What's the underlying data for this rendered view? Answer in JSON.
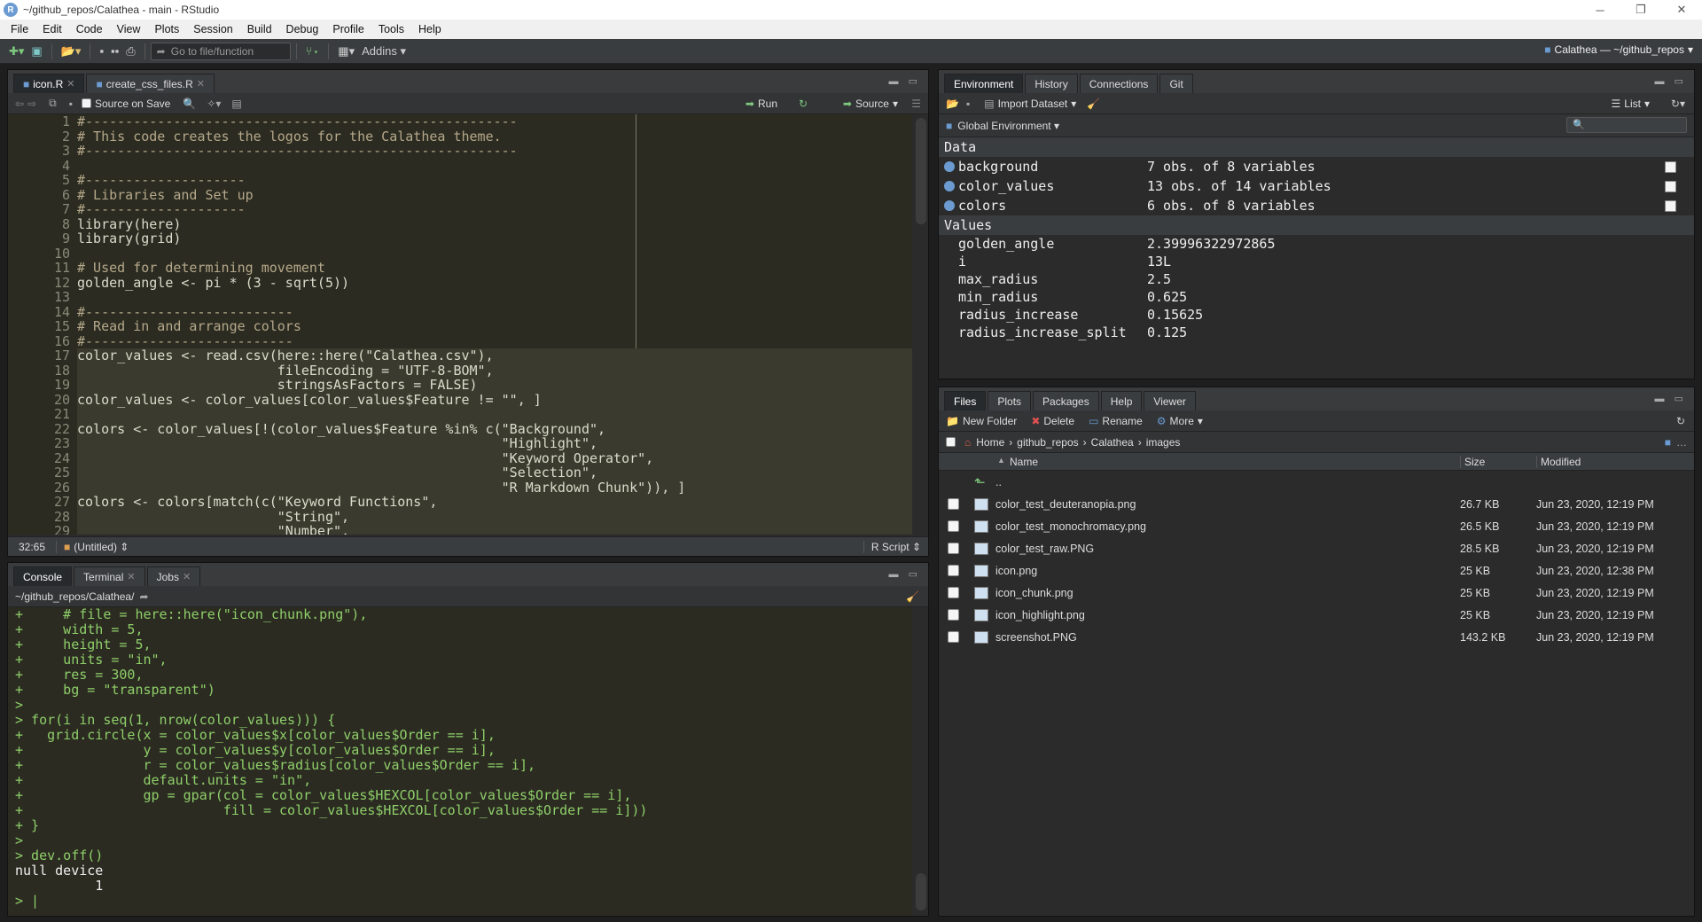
{
  "window": {
    "title": "~/github_repos/Calathea - main - RStudio",
    "app_icon": "R"
  },
  "menu": [
    "File",
    "Edit",
    "Code",
    "View",
    "Plots",
    "Session",
    "Build",
    "Debug",
    "Profile",
    "Tools",
    "Help"
  ],
  "toolbar": {
    "goto_placeholder": "Go to file/function",
    "addins": "Addins"
  },
  "project": "Calathea — ~/github_repos",
  "source": {
    "tabs": [
      {
        "label": "icon.R",
        "active": true
      },
      {
        "label": "create_css_files.R",
        "active": false
      }
    ],
    "source_on_save": "Source on Save",
    "run": "Run",
    "source": "Source",
    "line_numbers": [
      "1",
      "2",
      "3",
      "4",
      "5",
      "6",
      "7",
      "8",
      "9",
      "10",
      "11",
      "12",
      "13",
      "14",
      "15",
      "16",
      "17",
      "18",
      "19",
      "20",
      "21",
      "22",
      "23",
      "24",
      "25",
      "26",
      "27",
      "28",
      "29"
    ],
    "lines": [
      "#------------------------------------------------------",
      "# This code creates the logos for the Calathea theme.",
      "#------------------------------------------------------",
      "",
      "#--------------------",
      "# Libraries and Set up",
      "#--------------------",
      "library(here)",
      "library(grid)",
      "",
      "# Used for determining movement",
      "golden_angle <- pi * (3 - sqrt(5))",
      "",
      "#--------------------------",
      "# Read in and arrange colors",
      "#--------------------------",
      "color_values <- read.csv(here::here(\"Calathea.csv\"),",
      "                         fileEncoding = \"UTF-8-BOM\",",
      "                         stringsAsFactors = FALSE)",
      "color_values <- color_values[color_values$Feature != \"\", ]",
      "",
      "colors <- color_values[!(color_values$Feature %in% c(\"Background\",",
      "                                                     \"Highlight\",",
      "                                                     \"Keyword Operator\",",
      "                                                     \"Selection\",",
      "                                                     \"R Markdown Chunk\")), ]",
      "colors <- colors[match(c(\"Keyword Functions\",",
      "                         \"String\",",
      "                         \"Number\","
    ],
    "cursor": "32:65",
    "scope": "(Untitled)",
    "filetype": "R Script"
  },
  "console": {
    "tabs": [
      {
        "label": "Console",
        "active": true
      },
      {
        "label": "Terminal",
        "active": false
      },
      {
        "label": "Jobs",
        "active": false
      }
    ],
    "path": "~/github_repos/Calathea/",
    "lines": [
      {
        "t": "+     # file = here::here(\"icon_chunk.png\"),",
        "out": false
      },
      {
        "t": "+     width = 5,",
        "out": false
      },
      {
        "t": "+     height = 5,",
        "out": false
      },
      {
        "t": "+     units = \"in\",",
        "out": false
      },
      {
        "t": "+     res = 300,",
        "out": false
      },
      {
        "t": "+     bg = \"transparent\")",
        "out": false
      },
      {
        "t": ">",
        "out": false
      },
      {
        "t": "> for(i in seq(1, nrow(color_values))) {",
        "out": false
      },
      {
        "t": "+   grid.circle(x = color_values$x[color_values$Order == i],",
        "out": false
      },
      {
        "t": "+               y = color_values$y[color_values$Order == i],",
        "out": false
      },
      {
        "t": "+               r = color_values$radius[color_values$Order == i],",
        "out": false
      },
      {
        "t": "+               default.units = \"in\",",
        "out": false
      },
      {
        "t": "+               gp = gpar(col = color_values$HEXCOL[color_values$Order == i],",
        "out": false
      },
      {
        "t": "+                         fill = color_values$HEXCOL[color_values$Order == i]))",
        "out": false
      },
      {
        "t": "+ }",
        "out": false
      },
      {
        "t": ">",
        "out": false
      },
      {
        "t": "> dev.off()",
        "out": false
      },
      {
        "t": "null device",
        "out": true
      },
      {
        "t": "          1",
        "out": true
      },
      {
        "t": "> |",
        "out": false
      }
    ]
  },
  "environment": {
    "tabs": [
      {
        "label": "Environment",
        "active": true
      },
      {
        "label": "History",
        "active": false
      },
      {
        "label": "Connections",
        "active": false
      },
      {
        "label": "Git",
        "active": false
      }
    ],
    "import": "Import Dataset",
    "list": "List",
    "scope": "Global Environment",
    "data_header": "Data",
    "data": [
      {
        "name": "background",
        "value": "7 obs. of 8 variables"
      },
      {
        "name": "color_values",
        "value": "13 obs. of 14 variables"
      },
      {
        "name": "colors",
        "value": "6 obs. of 8 variables"
      }
    ],
    "values_header": "Values",
    "values": [
      {
        "name": "golden_angle",
        "value": "2.39996322972865"
      },
      {
        "name": "i",
        "value": "13L"
      },
      {
        "name": "max_radius",
        "value": "2.5"
      },
      {
        "name": "min_radius",
        "value": "0.625"
      },
      {
        "name": "radius_increase",
        "value": "0.15625"
      },
      {
        "name": "radius_increase_split",
        "value": "0.125"
      }
    ]
  },
  "files": {
    "tabs": [
      {
        "label": "Files",
        "active": true
      },
      {
        "label": "Plots",
        "active": false
      },
      {
        "label": "Packages",
        "active": false
      },
      {
        "label": "Help",
        "active": false
      },
      {
        "label": "Viewer",
        "active": false
      }
    ],
    "new_folder": "New Folder",
    "delete": "Delete",
    "rename": "Rename",
    "more": "More",
    "crumbs": [
      "Home",
      "github_repos",
      "Calathea",
      "images"
    ],
    "col_name": "Name",
    "col_size": "Size",
    "col_modified": "Modified",
    "up": "..",
    "rows": [
      {
        "name": "color_test_deuteranopia.png",
        "size": "26.7 KB",
        "modified": "Jun 23, 2020, 12:19 PM"
      },
      {
        "name": "color_test_monochromacy.png",
        "size": "26.5 KB",
        "modified": "Jun 23, 2020, 12:19 PM"
      },
      {
        "name": "color_test_raw.PNG",
        "size": "28.5 KB",
        "modified": "Jun 23, 2020, 12:19 PM"
      },
      {
        "name": "icon.png",
        "size": "25 KB",
        "modified": "Jun 23, 2020, 12:38 PM"
      },
      {
        "name": "icon_chunk.png",
        "size": "25 KB",
        "modified": "Jun 23, 2020, 12:19 PM"
      },
      {
        "name": "icon_highlight.png",
        "size": "25 KB",
        "modified": "Jun 23, 2020, 12:19 PM"
      },
      {
        "name": "screenshot.PNG",
        "size": "143.2 KB",
        "modified": "Jun 23, 2020, 12:19 PM"
      }
    ]
  }
}
